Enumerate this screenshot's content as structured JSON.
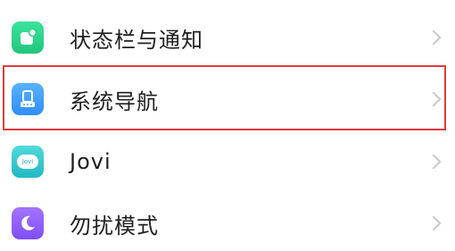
{
  "settings": {
    "items": [
      {
        "label": "状态栏与通知",
        "icon": "status-bar-notification-icon",
        "color": "#2fd08a"
      },
      {
        "label": "系统导航",
        "icon": "system-navigation-icon",
        "color": "#3ea0ff"
      },
      {
        "label": "Jovi",
        "icon": "jovi-icon",
        "icon_text": "Jovi",
        "color": "#37c7c9"
      },
      {
        "label": "勿扰模式",
        "icon": "do-not-disturb-moon-icon",
        "color": "#8c5cff"
      }
    ],
    "highlight_color": "#e23b3b"
  }
}
